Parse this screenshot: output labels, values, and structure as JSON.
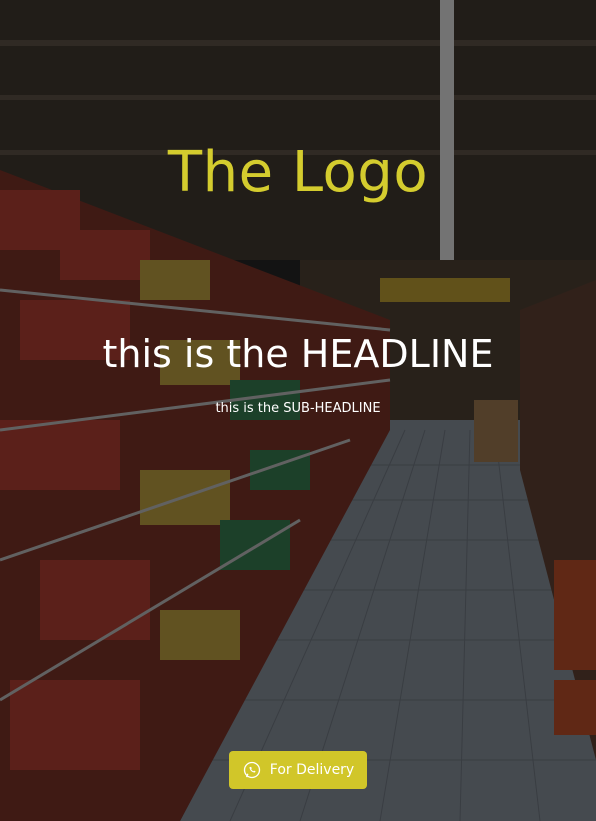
{
  "logo": {
    "text": "The Logo"
  },
  "hero": {
    "headline": "this is the HEADLINE",
    "subheadline": "this is the SUB-HEADLINE"
  },
  "cta": {
    "label": "For Delivery",
    "icon": "whatsapp-icon"
  },
  "colors": {
    "accent": "#d1c629",
    "logo": "#d4cc2e",
    "overlay": "rgba(0,0,0,0.55)"
  }
}
